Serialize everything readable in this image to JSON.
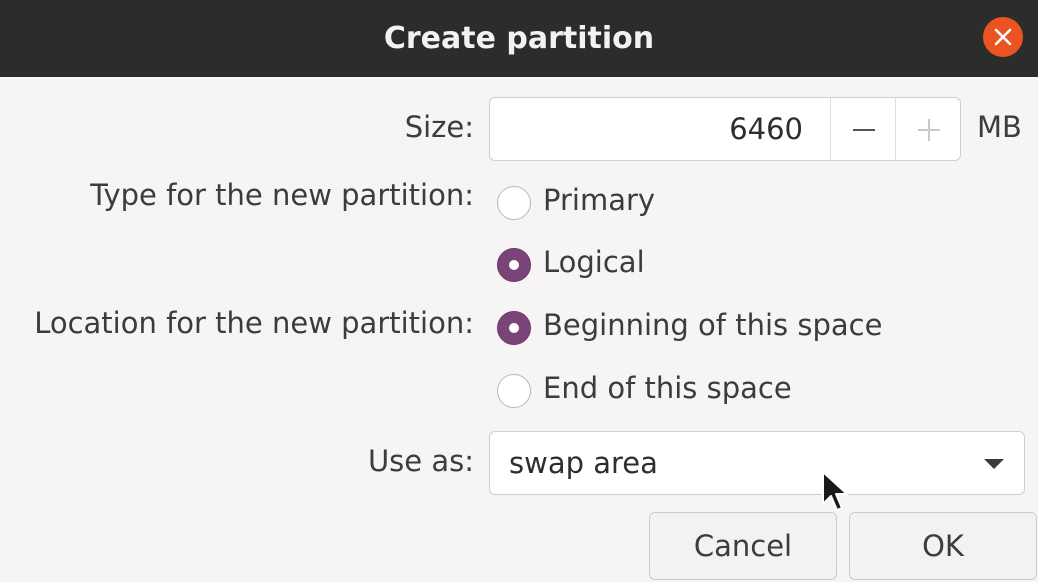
{
  "dialog": {
    "title": "Create partition"
  },
  "size": {
    "label": "Size:",
    "value": "6460",
    "unit": "MB"
  },
  "type": {
    "label": "Type for the new partition:",
    "options": [
      {
        "label": "Primary",
        "selected": false
      },
      {
        "label": "Logical",
        "selected": true
      }
    ]
  },
  "location": {
    "label": "Location for the new partition:",
    "options": [
      {
        "label": "Beginning of this space",
        "selected": true
      },
      {
        "label": "End of this space",
        "selected": false
      }
    ]
  },
  "use_as": {
    "label": "Use as:",
    "value": "swap area"
  },
  "buttons": {
    "cancel": "Cancel",
    "ok": "OK"
  },
  "colors": {
    "titlebar": "#2c2c2c",
    "close_button": "#e95420",
    "radio_selected": "#7b4479",
    "background": "#f6f5f4"
  },
  "icons": [
    "close-icon",
    "minus-icon",
    "plus-icon",
    "dropdown-arrow-icon",
    "mouse-pointer-icon"
  ]
}
